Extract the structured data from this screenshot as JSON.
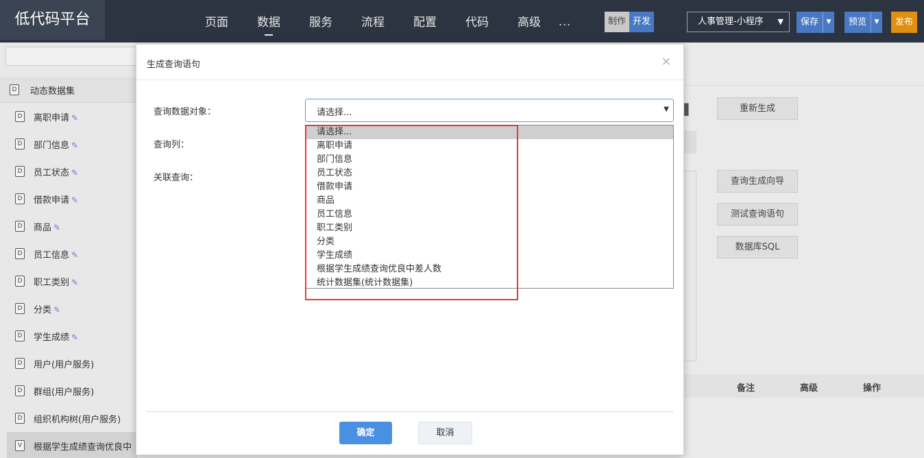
{
  "app": {
    "logo": "低代码平台"
  },
  "topnav": {
    "items": [
      "页面",
      "数据",
      "服务",
      "流程",
      "配置",
      "代码",
      "高级"
    ],
    "more": "...",
    "mode_make": "制作",
    "mode_dev": "开发",
    "app_select": "人事管理-小程序",
    "save": "保存",
    "preview": "预览",
    "publish": "发布"
  },
  "sidebar": {
    "search_placeholder": "",
    "header": "动态数据集",
    "header_icon": "D",
    "items": [
      {
        "label": "离职申请",
        "icon": "D",
        "editable": true
      },
      {
        "label": "部门信息",
        "icon": "D",
        "editable": true
      },
      {
        "label": "员工状态",
        "icon": "D",
        "editable": true
      },
      {
        "label": "借款申请",
        "icon": "D",
        "editable": true
      },
      {
        "label": "商品",
        "icon": "D",
        "editable": true
      },
      {
        "label": "员工信息",
        "icon": "D",
        "editable": true
      },
      {
        "label": "职工类别",
        "icon": "D",
        "editable": true
      },
      {
        "label": "分类",
        "icon": "D",
        "editable": true
      },
      {
        "label": "学生成绩",
        "icon": "D",
        "editable": true
      },
      {
        "label": "用户(用户服务)",
        "icon": "D",
        "editable": false
      },
      {
        "label": "群组(用户服务)",
        "icon": "D",
        "editable": false
      },
      {
        "label": "组织机构树(用户服务)",
        "icon": "D",
        "editable": false
      },
      {
        "label": "根据学生成绩查询优良中",
        "icon": "V",
        "editable": false
      }
    ]
  },
  "right_panel": {
    "regenerate": "重新生成",
    "wizard": "查询生成向导",
    "test_query": "测试查询语句",
    "db_sql": "数据库SQL",
    "table_headers": [
      "备注",
      "高级",
      "操作"
    ]
  },
  "modal": {
    "title": "生成查询语句",
    "close": "×",
    "label_object": "查询数据对象：",
    "label_columns": "查询列：",
    "label_join": "关联查询：",
    "select_value": "请选择...",
    "options": [
      "请选择...",
      "离职申请",
      "部门信息",
      "员工状态",
      "借款申请",
      "商品",
      "员工信息",
      "职工类别",
      "分类",
      "学生成绩",
      "根据学生成绩查询优良中差人数",
      "统计数据集(统计数据集)"
    ],
    "ok": "确定",
    "cancel": "取消"
  },
  "colors": {
    "topbar": "#2b3440",
    "accent_blue": "#4a79c4",
    "publish_orange": "#e08f10",
    "highlight_red": "#e53935",
    "ok_blue": "#4a90e2"
  }
}
